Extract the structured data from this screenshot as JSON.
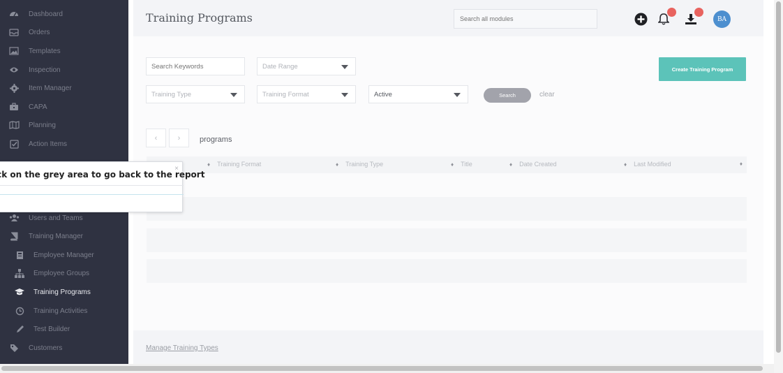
{
  "sidebar": {
    "items": [
      {
        "label": "Dashboard",
        "icon": "dashboard-icon"
      },
      {
        "label": "Orders",
        "icon": "inbox-icon"
      },
      {
        "label": "Templates",
        "icon": "image-icon"
      },
      {
        "label": "Inspection",
        "icon": "eye-icon"
      },
      {
        "label": "Item Manager",
        "icon": "gear-icon"
      },
      {
        "label": "CAPA",
        "icon": "briefcase-icon"
      },
      {
        "label": "Planning",
        "icon": "map-icon"
      },
      {
        "label": "Action Items",
        "icon": "checkbox-icon"
      },
      {
        "label": "Users and Teams",
        "icon": "users-icon"
      },
      {
        "label": "Training Manager",
        "icon": "book-icon"
      },
      {
        "label": "Employee Manager",
        "icon": "id-card-icon"
      },
      {
        "label": "Employee Groups",
        "icon": "sitemap-icon"
      },
      {
        "label": "Training Programs",
        "icon": "graduation-cap-icon"
      },
      {
        "label": "Training Activities",
        "icon": "clock-icon"
      },
      {
        "label": "Test Builder",
        "icon": "pencil-icon"
      },
      {
        "label": "Customers",
        "icon": "tag-icon"
      }
    ]
  },
  "header": {
    "title": "Training Programs",
    "search_placeholder": "Search all modules",
    "avatar_initials": "BA"
  },
  "filters": {
    "keywords_placeholder": "Search Keywords",
    "date_range": "Date Range",
    "training_type": "Training Type",
    "training_format": "Training Format",
    "status": "Active",
    "search_label": "Search",
    "clear_label": "clear",
    "create_label": "Create Training Program"
  },
  "pager": {
    "prev": "‹",
    "next": "›",
    "label": "programs"
  },
  "table": {
    "columns": [
      "Training Format",
      "Training Type",
      "Title",
      "Date Created",
      "Last Modified"
    ]
  },
  "footer": {
    "manage_link": "Manage Training Types"
  },
  "popover": {
    "text": "ick on the grey area to go back to the report",
    "close": "×"
  },
  "colors": {
    "sidebar_bg": "#2f3241",
    "accent": "#5cc3b9",
    "badge": "#e8635f",
    "avatar": "#4d8fcf"
  }
}
